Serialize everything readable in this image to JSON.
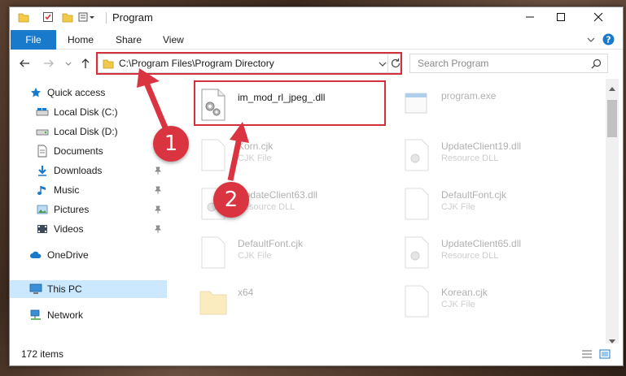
{
  "window": {
    "title": "Program",
    "controls": {
      "minimize": "minimize",
      "maximize": "maximize",
      "close": "close"
    }
  },
  "ribbon": {
    "tabs": [
      "File",
      "Home",
      "Share",
      "View"
    ],
    "active_tab": "File"
  },
  "navbar": {
    "address": "C:\\Program Files\\Program Directory",
    "search_placeholder": "Search Program"
  },
  "sidebar": {
    "items": [
      {
        "label": "Quick access",
        "icon": "star-icon"
      },
      {
        "label": "Local Disk (C:)",
        "icon": "drive-icon"
      },
      {
        "label": "Local Disk (D:)",
        "icon": "drive-icon"
      },
      {
        "label": "Documents",
        "icon": "documents-icon",
        "pinned": true
      },
      {
        "label": "Downloads",
        "icon": "download-icon",
        "pinned": true
      },
      {
        "label": "Music",
        "icon": "music-icon",
        "pinned": true
      },
      {
        "label": "Pictures",
        "icon": "pictures-icon",
        "pinned": true
      },
      {
        "label": "Videos",
        "icon": "videos-icon",
        "pinned": true
      },
      {
        "label": "OneDrive",
        "icon": "cloud-icon"
      },
      {
        "label": "This PC",
        "icon": "computer-icon",
        "selected": true
      },
      {
        "label": "Network",
        "icon": "network-icon"
      }
    ]
  },
  "files": [
    {
      "name": "im_mod_rl_jpeg_.dll",
      "type": "",
      "highlighted": true
    },
    {
      "name": "program.exe",
      "type": ""
    },
    {
      "name": "Korn.cjk",
      "type": "CJK File"
    },
    {
      "name": "UpdateClient19.dll",
      "type": "Resource DLL"
    },
    {
      "name": "UpdateClient63.dll",
      "type": "Resource DLL"
    },
    {
      "name": "DefaultFont.cjk",
      "type": "CJK File"
    },
    {
      "name": "DefaultFont.cjk",
      "type": "CJK File"
    },
    {
      "name": "UpdateClient65.dll",
      "type": "Resource DLL"
    },
    {
      "name": "x64",
      "type": ""
    },
    {
      "name": "Korean.cjk",
      "type": "CJK File"
    }
  ],
  "status": {
    "count": "172 items"
  },
  "callouts": [
    "1",
    "2"
  ],
  "colors": {
    "accent": "#1979ca",
    "highlight": "#d2303c",
    "selection": "#cce8ff"
  }
}
